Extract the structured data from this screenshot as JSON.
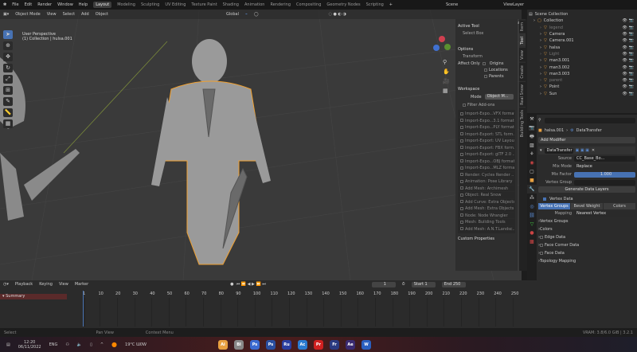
{
  "menu": [
    "File",
    "Edit",
    "Render",
    "Window",
    "Help"
  ],
  "workspaces": [
    "Layout",
    "Modeling",
    "Sculpting",
    "UV Editing",
    "Texture Paint",
    "Shading",
    "Animation",
    "Rendering",
    "Compositing",
    "Geometry Nodes",
    "Scripting"
  ],
  "scene": "Scene",
  "view_layer": "ViewLayer",
  "viewport": {
    "mode": "Object Mode",
    "menus": [
      "View",
      "Select",
      "Add",
      "Object"
    ],
    "orientation": "Global",
    "perspective": "User Perspective",
    "collection": "(1) Collection | hulsa.001",
    "options": "Options"
  },
  "npanel": {
    "active_tool": "Active Tool",
    "select_box": "Select Box",
    "options": "Options",
    "transform": "Transform",
    "affect_only": "Affect Only",
    "origins": "Origins",
    "locations": "Locations",
    "parents": "Parents",
    "workspace": "Workspace",
    "mode_label": "Mode",
    "mode_value": "Object M...",
    "filter_addons": "Filter Add-ons",
    "addons": [
      "Import-Expo...VFX format",
      "Import-Expo...3.1 format",
      "Import-Expo...PLY format",
      "Import-Export: STL form..",
      "Import-Export: UV Layout",
      "Import-Export: FBX form..",
      "Import-Export: glTF 2.0 ..",
      "Import-Expo...OBJ format",
      "Import-Expo...MLZ format",
      "Render: Cycles Render ..",
      "Animation: Pose Library",
      "Add Mesh: Archimesh",
      "Object: Real Snow",
      "Add Curve: Extra Objects",
      "Add Mesh: Extra Objects",
      "Node: Node Wrangler",
      "Mesh: Building Tools",
      "Add Mesh: A.N.T.Landsc.."
    ],
    "custom_properties": "Custom Properties",
    "tabs": [
      "Item",
      "Tool",
      "View",
      "Create",
      "Real Snow",
      "Building Tools"
    ]
  },
  "outliner": {
    "root": "Scene Collection",
    "items": [
      {
        "name": "Collection",
        "dim": false,
        "indent": 0
      },
      {
        "name": "legend",
        "dim": true,
        "indent": 1
      },
      {
        "name": "Camera",
        "dim": false,
        "indent": 1
      },
      {
        "name": "Camera.001",
        "dim": false,
        "indent": 1
      },
      {
        "name": "halsa",
        "dim": false,
        "indent": 1
      },
      {
        "name": "Light",
        "dim": true,
        "indent": 1
      },
      {
        "name": "man3.001",
        "dim": false,
        "indent": 1
      },
      {
        "name": "man3.002",
        "dim": false,
        "indent": 1
      },
      {
        "name": "man3.003",
        "dim": false,
        "indent": 1
      },
      {
        "name": "parent",
        "dim": true,
        "indent": 1
      },
      {
        "name": "Point",
        "dim": false,
        "indent": 1
      },
      {
        "name": "Sun",
        "dim": false,
        "indent": 1
      }
    ]
  },
  "properties": {
    "object": "halsa.001",
    "modifier_crumb": "DataTransfer",
    "add_modifier": "Add Modifier",
    "modifier_name": "DataTransfer",
    "source_label": "Source",
    "source": "CC_Base_Bo...",
    "mix_mode_label": "Mix Mode",
    "mix_mode": "Replace",
    "mix_factor_label": "Mix Factor",
    "mix_factor": "1.000",
    "vertex_group_label": "Vertex Group",
    "generate": "Generate Data Layers",
    "vertex_data": "Vertex Data",
    "vtabs": [
      "Vertex Groups",
      "Bevel Weight",
      "Colors"
    ],
    "mapping_label": "Mapping",
    "mapping": "Nearest Vertex",
    "sections": [
      "Vertex Groups",
      "Colors",
      "Edge Data",
      "Face Corner Data",
      "Face Data",
      "Topology Mapping"
    ]
  },
  "timeline": {
    "menus": [
      "Playback",
      "Keying",
      "View",
      "Marker"
    ],
    "current": "1",
    "start_label": "Start",
    "start": "1",
    "end_label": "End",
    "end": "250",
    "summary": "Summary",
    "ticks": [
      "1",
      "10",
      "20",
      "30",
      "40",
      "50",
      "60",
      "70",
      "80",
      "90",
      "100",
      "110",
      "120",
      "130",
      "140",
      "150",
      "160",
      "170",
      "180",
      "190",
      "200",
      "210",
      "220",
      "230",
      "240",
      "250"
    ]
  },
  "status": {
    "select": "Select",
    "pan": "Pan View",
    "context": "Context Menu",
    "vram": "VRAM: 3.8/6.0 GiB | 3.2.1"
  },
  "taskbar": {
    "time": "12:20",
    "date": "06/11/2022",
    "lang": "ENG",
    "weather": "19°C  Ɯ0W",
    "apps": [
      "Ai",
      "Bl",
      "Ps",
      "Ps",
      "Ru",
      "Ac",
      "Pr",
      "Fr",
      "Ae",
      "W"
    ]
  }
}
